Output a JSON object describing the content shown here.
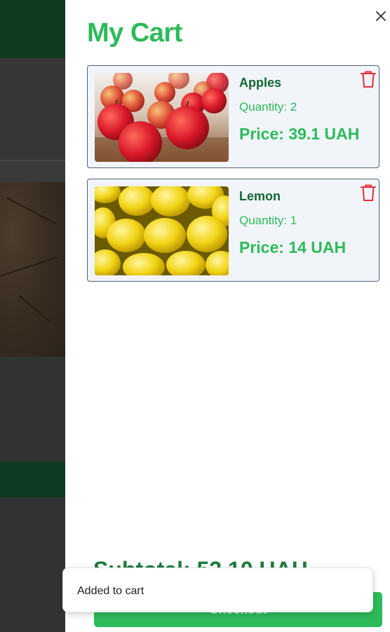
{
  "cart": {
    "title": "My Cart",
    "items": [
      {
        "name": "Apples",
        "quantity_label": "Quantity: ",
        "quantity": "2",
        "price_label": "Price: ",
        "price": "39.1 UAH",
        "image": "apples-photo"
      },
      {
        "name": "Lemon",
        "quantity_label": "Quantity: ",
        "quantity": "1",
        "price_label": "Price: ",
        "price": "14 UAH",
        "image": "lemons-photo"
      }
    ],
    "subtotal": "Subtotal: 53.10 UAH",
    "checkout_label": "Checkout"
  },
  "toast": {
    "message": "Added to cart"
  },
  "icons": {
    "close": "close-icon",
    "delete": "trash-icon"
  },
  "colors": {
    "accent": "#2dbb5a",
    "item_name": "#116634",
    "delete": "#e0313a",
    "card_bg": "#f1f4f9",
    "card_border": "#52607a",
    "backdrop_header": "#0e3a20"
  }
}
